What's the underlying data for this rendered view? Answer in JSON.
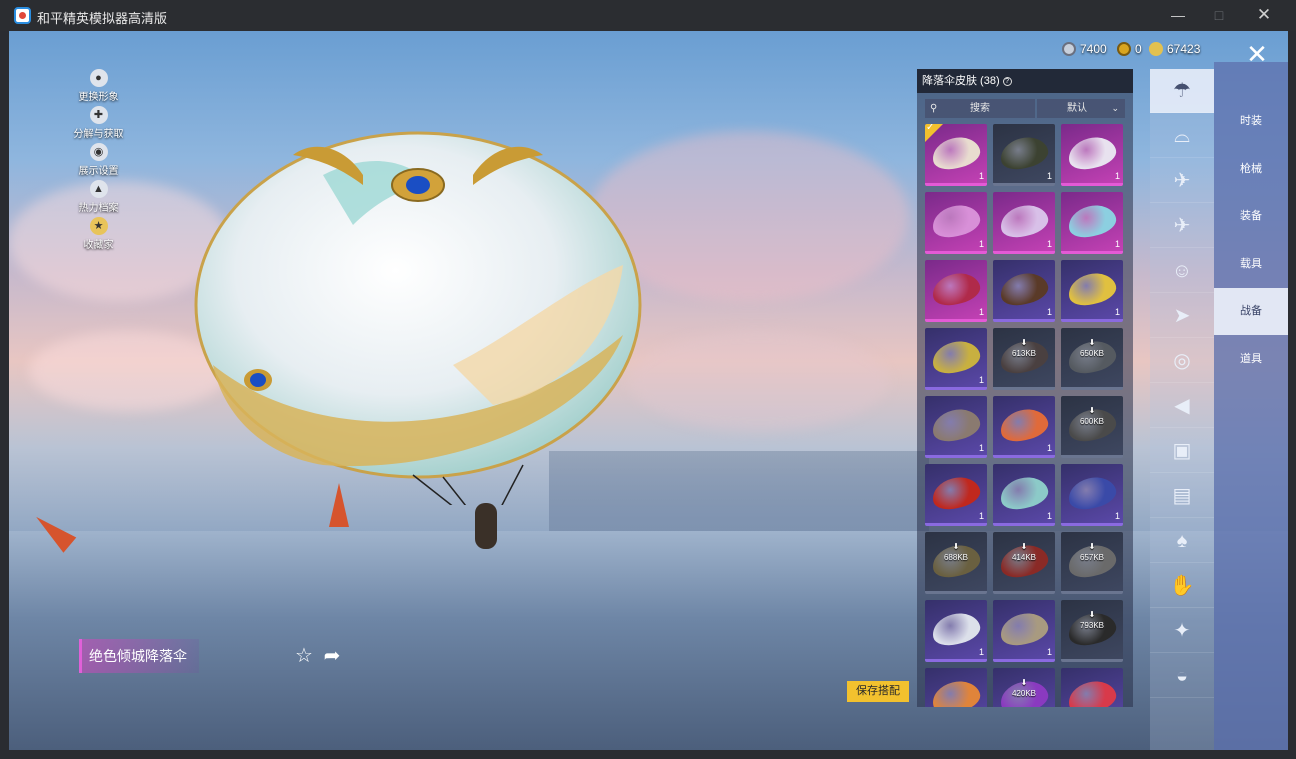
{
  "window": {
    "title": "和平精英模拟器高清版",
    "minimize_icon": "minimize-icon",
    "maximize_icon": "maximize-icon",
    "close_icon": "close-icon"
  },
  "currencies": [
    {
      "icon": "silver-coin-icon",
      "value": "7400",
      "color": "#c8d0dc"
    },
    {
      "icon": "gold-token-icon",
      "value": "0",
      "color": "#d9a520"
    },
    {
      "icon": "coupon-icon",
      "value": "67423",
      "color": "#e3c150"
    }
  ],
  "side_menu": [
    {
      "label": "更换形象",
      "icon": "person-icon"
    },
    {
      "label": "分解与获取",
      "icon": "puzzle-icon"
    },
    {
      "label": "展示设置",
      "icon": "eye-icon"
    },
    {
      "label": "热力档案",
      "icon": "flame-icon"
    },
    {
      "label": "收藏家",
      "icon": "trophy-icon"
    }
  ],
  "item": {
    "name": "绝色倾城降落伞",
    "favorite_icon": "star-plus-icon",
    "share_icon": "share-icon"
  },
  "save_button": "保存搭配",
  "panel": {
    "title": "降落伞皮肤 (38)",
    "search_placeholder": "搜索",
    "sort_value": "默认",
    "items": [
      {
        "rarity": "pink",
        "color": "#e8dccf",
        "count": "1",
        "selected": true
      },
      {
        "rarity": "gray",
        "color": "#3c4231",
        "count": "1"
      },
      {
        "rarity": "pink",
        "color": "#e8e2ef",
        "count": "1"
      },
      {
        "rarity": "pink",
        "color": "#d890d8",
        "count": "1"
      },
      {
        "rarity": "pink",
        "color": "#d8c0e8",
        "count": "1"
      },
      {
        "rarity": "pink",
        "color": "#8ccfe0",
        "count": "1"
      },
      {
        "rarity": "pink",
        "color": "#b02a4a",
        "count": "1"
      },
      {
        "rarity": "purple",
        "color": "#5a3a28",
        "count": "1"
      },
      {
        "rarity": "purple",
        "color": "#e0c040",
        "count": "1"
      },
      {
        "rarity": "purple",
        "color": "#c8b040",
        "count": "1"
      },
      {
        "rarity": "gray",
        "color": "#4a4040",
        "download": "613KB"
      },
      {
        "rarity": "gray",
        "color": "#555a60",
        "download": "650KB"
      },
      {
        "rarity": "purple",
        "color": "#8a7a70",
        "count": "1"
      },
      {
        "rarity": "purple",
        "color": "#e06a3a",
        "count": "1"
      },
      {
        "rarity": "gray",
        "color": "#4a4a4a",
        "download": "600KB"
      },
      {
        "rarity": "purple",
        "color": "#c0281e",
        "count": "1"
      },
      {
        "rarity": "purple",
        "color": "#8ccac8",
        "count": "1"
      },
      {
        "rarity": "purple",
        "color": "#3a4aa8",
        "count": "1"
      },
      {
        "rarity": "gray",
        "color": "#6a6040",
        "download": "688KB"
      },
      {
        "rarity": "gray",
        "color": "#8a2a26",
        "download": "414KB"
      },
      {
        "rarity": "gray",
        "color": "#6a6a6a",
        "download": "657KB"
      },
      {
        "rarity": "purple",
        "color": "#dce0ea",
        "count": "1"
      },
      {
        "rarity": "purple",
        "color": "#a89a80",
        "count": "1"
      },
      {
        "rarity": "gray",
        "color": "#2a2a2a",
        "download": "793KB"
      },
      {
        "rarity": "purple",
        "color": "#e0843a"
      },
      {
        "rarity": "purple",
        "color": "#8a3ac0",
        "download": "420KB"
      },
      {
        "rarity": "purple",
        "color": "#d83a4a"
      }
    ]
  },
  "icon_column": [
    {
      "icon": "parachute-icon",
      "glyph": "☂",
      "active": true
    },
    {
      "icon": "glider-icon",
      "glyph": "⌓"
    },
    {
      "icon": "drone-icon",
      "glyph": "✈"
    },
    {
      "icon": "plane-icon",
      "glyph": "✈"
    },
    {
      "icon": "emote-icon",
      "glyph": "☺"
    },
    {
      "icon": "jet-icon",
      "glyph": "➤"
    },
    {
      "icon": "pet-icon",
      "glyph": "◎"
    },
    {
      "icon": "speaker-icon",
      "glyph": "◀"
    },
    {
      "icon": "chat-icon",
      "glyph": "▣"
    },
    {
      "icon": "photo-icon",
      "glyph": "▤"
    },
    {
      "icon": "spray-icon",
      "glyph": "♠"
    },
    {
      "icon": "hand-icon",
      "glyph": "✋"
    },
    {
      "icon": "wand-icon",
      "glyph": "✦"
    },
    {
      "icon": "ufo-icon",
      "glyph": "◒"
    }
  ],
  "categories": [
    {
      "label": "时装"
    },
    {
      "label": "枪械"
    },
    {
      "label": "装备"
    },
    {
      "label": "载具"
    },
    {
      "label": "战备",
      "active": true
    },
    {
      "label": "道具"
    }
  ]
}
